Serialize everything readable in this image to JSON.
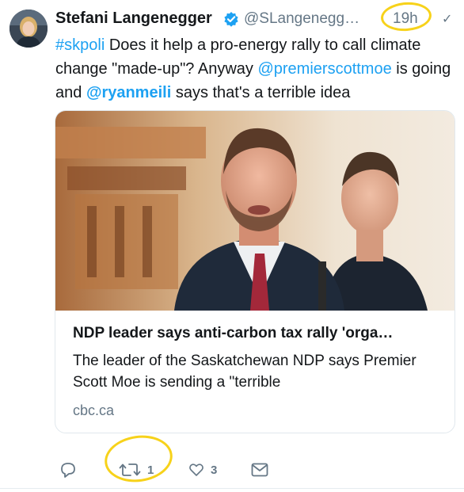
{
  "tweet": {
    "author_name": "Stefani Langenegger",
    "handle": "@SLangenegg…",
    "separator": "·",
    "time": "19h",
    "text_parts": {
      "hashtag": "#skpoli",
      "body1": " Does it help a pro-energy rally to call climate change \"made-up\"? Anyway ",
      "mention1": "@premierscottmoe",
      "body2": " is going and ",
      "mention2": "@ryanmeili",
      "body3": " says that's a terrible idea"
    }
  },
  "card": {
    "title": "NDP leader says anti-carbon tax rally 'orga…",
    "description": "The leader of the Saskatchewan NDP says Premier Scott Moe is sending a \"terrible",
    "url": "cbc.ca"
  },
  "actions": {
    "reply_icon": "reply-icon",
    "retweet_icon": "retweet-icon",
    "retweet_count": "1",
    "like_icon": "heart-icon",
    "like_count": "3",
    "dm_icon": "envelope-icon"
  },
  "colors": {
    "link": "#1da1f2",
    "secondary": "#657786",
    "highlight_circle": "#f7d21a"
  }
}
